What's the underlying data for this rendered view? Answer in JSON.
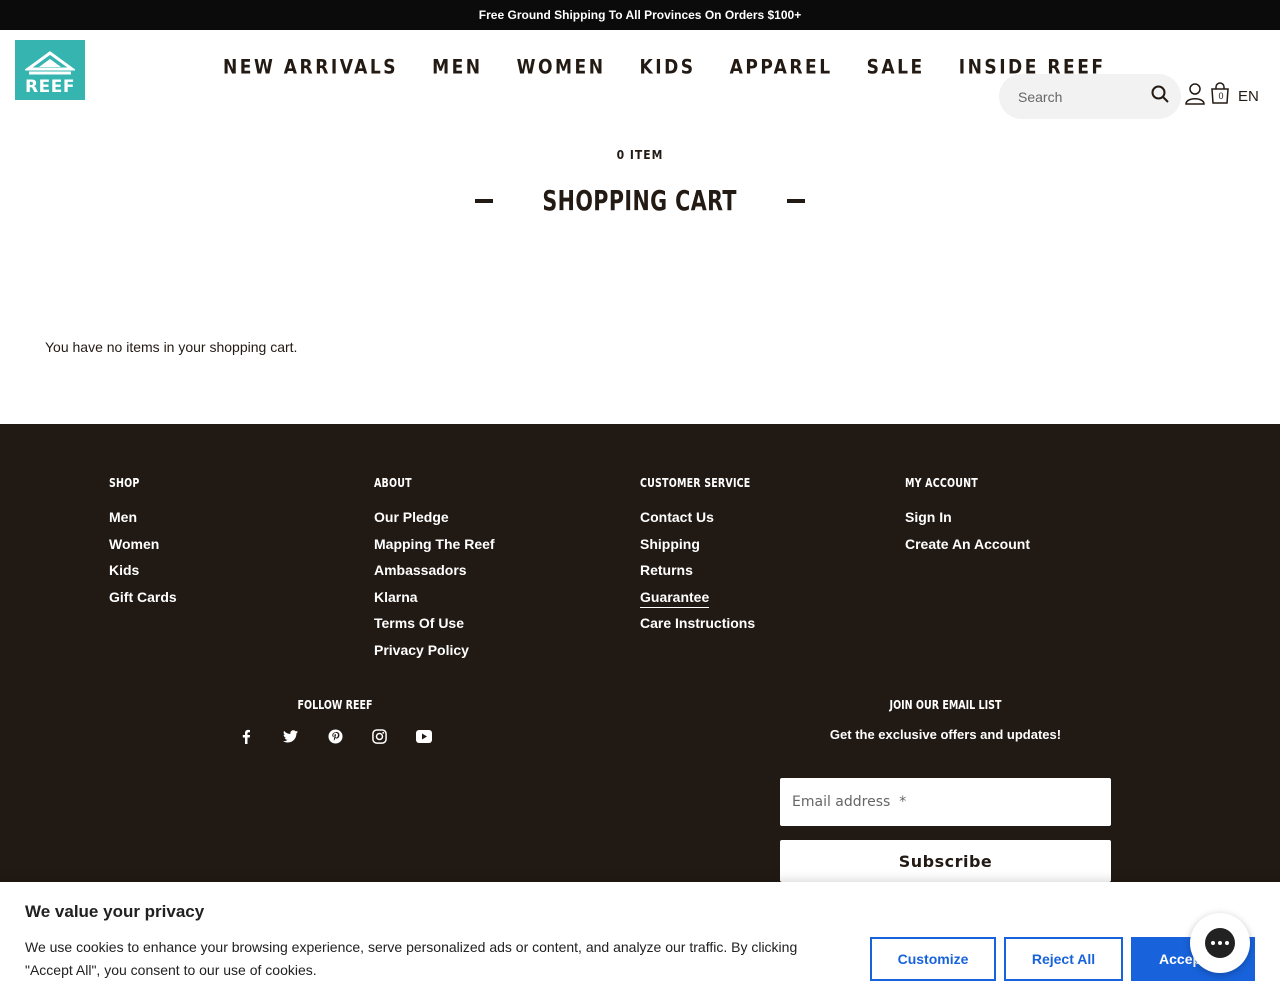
{
  "announcement": "Free Ground Shipping To All Provinces On Orders $100+",
  "logo": {
    "text": "REEF",
    "color": "#35b4b0"
  },
  "nav": [
    "NEW ARRIVALS",
    "MEN",
    "WOMEN",
    "KIDS",
    "APPAREL",
    "SALE",
    "INSIDE REEF"
  ],
  "search": {
    "placeholder": "Search"
  },
  "header_icons": {
    "account": "user-icon",
    "cart": "shopping-bag-icon",
    "cart_count": "0",
    "language": "EN"
  },
  "cart": {
    "item_count": "0 ITEM",
    "title": "SHOPPING CART",
    "empty_message": "You have no items in your shopping cart."
  },
  "footer": {
    "columns": [
      {
        "heading": "SHOP",
        "links": [
          "Men",
          "Women",
          "Kids",
          "Gift Cards"
        ]
      },
      {
        "heading": "ABOUT",
        "links": [
          "Our Pledge",
          "Mapping The Reef",
          "Ambassadors",
          "Klarna",
          "Terms Of Use",
          "Privacy Policy"
        ]
      },
      {
        "heading": "CUSTOMER SERVICE",
        "links": [
          "Contact Us",
          "Shipping",
          "Returns",
          "Guarantee",
          "Care Instructions"
        ]
      },
      {
        "heading": "MY ACCOUNT",
        "links": [
          "Sign In",
          "Create An Account"
        ]
      }
    ],
    "follow": {
      "heading": "FOLLOW REEF",
      "icons": [
        "facebook-icon",
        "twitter-icon",
        "pinterest-icon",
        "instagram-icon",
        "youtube-icon"
      ]
    },
    "newsletter": {
      "heading": "JOIN OUR EMAIL LIST",
      "subtext": "Get the exclusive offers and updates!",
      "email_placeholder": "Email address  *",
      "subscribe_label": "Subscribe"
    },
    "background": "#211913"
  },
  "cookie_banner": {
    "title": "We value your privacy",
    "text": "We use cookies to enhance your browsing experience, serve personalized ads or content, and analyze our traffic. By clicking \"Accept All\", you consent to our use of cookies.",
    "customize_label": "Customize",
    "reject_label": "Reject All",
    "accept_label": "Accept All",
    "accent": "#1863dc"
  },
  "chat_widget": {
    "icon": "chat-bubble-icon"
  }
}
